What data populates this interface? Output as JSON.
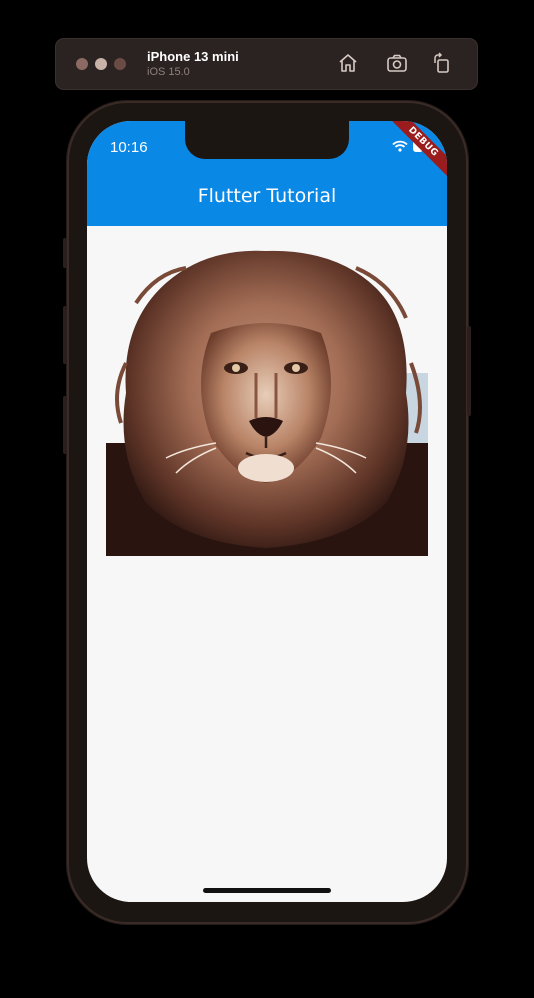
{
  "simulator": {
    "device_name": "iPhone 13 mini",
    "os_version": "iOS 15.0",
    "toolbar_icons": [
      "home-icon",
      "screenshot-icon",
      "rotate-icon"
    ]
  },
  "status_bar": {
    "time": "10:16",
    "icons": [
      "wifi-icon",
      "battery-icon"
    ]
  },
  "app_bar": {
    "title": "Flutter Tutorial",
    "color": "#0a88e6"
  },
  "debug_banner": "DEBUG",
  "content": {
    "image": "lion-image"
  }
}
